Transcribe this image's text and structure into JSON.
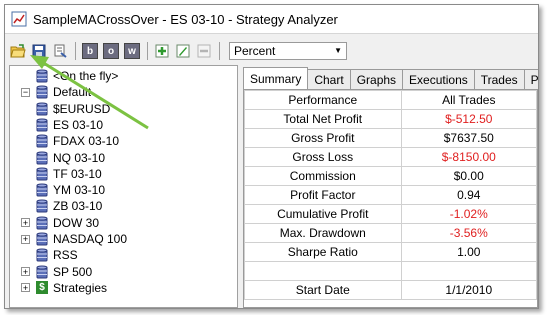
{
  "window": {
    "title": "SampleMACrossOver - ES 03-10 - Strategy Analyzer"
  },
  "toolbar": {
    "letter_buttons": [
      "b",
      "o",
      "w"
    ],
    "display_combo": "Percent"
  },
  "tree": {
    "items": [
      {
        "label": "<On the fly>",
        "level": 1,
        "expander": "",
        "icon": "database-icon"
      },
      {
        "label": "Default",
        "level": 0,
        "expander": "−",
        "icon": "database-icon"
      },
      {
        "label": "$EURUSD",
        "level": 1,
        "expander": "",
        "icon": "database-icon"
      },
      {
        "label": "ES 03-10",
        "level": 1,
        "expander": "",
        "icon": "database-icon"
      },
      {
        "label": "FDAX 03-10",
        "level": 1,
        "expander": "",
        "icon": "database-icon"
      },
      {
        "label": "NQ 03-10",
        "level": 1,
        "expander": "",
        "icon": "database-icon"
      },
      {
        "label": "TF 03-10",
        "level": 1,
        "expander": "",
        "icon": "database-icon"
      },
      {
        "label": "YM 03-10",
        "level": 1,
        "expander": "",
        "icon": "database-icon"
      },
      {
        "label": "ZB 03-10",
        "level": 1,
        "expander": "",
        "icon": "database-icon"
      },
      {
        "label": "DOW 30",
        "level": 0,
        "expander": "+",
        "icon": "database-icon"
      },
      {
        "label": "NASDAQ 100",
        "level": 0,
        "expander": "+",
        "icon": "database-icon"
      },
      {
        "label": "RSS",
        "level": 0,
        "expander": "",
        "icon": "database-icon"
      },
      {
        "label": "SP 500",
        "level": 0,
        "expander": "+",
        "icon": "database-icon"
      },
      {
        "label": "Strategies",
        "level": 0,
        "expander": "+",
        "icon": "strategy-icon"
      }
    ]
  },
  "tabs": [
    "Summary",
    "Chart",
    "Graphs",
    "Executions",
    "Trades",
    "Periods"
  ],
  "summary": {
    "headers": [
      "Performance",
      "All Trades"
    ],
    "rows": [
      {
        "label": "Total Net Profit",
        "value": "$-512.50",
        "negative": true
      },
      {
        "label": "Gross Profit",
        "value": "$7637.50",
        "negative": false
      },
      {
        "label": "Gross Loss",
        "value": "$-8150.00",
        "negative": true
      },
      {
        "label": "Commission",
        "value": "$0.00",
        "negative": false
      },
      {
        "label": "Profit Factor",
        "value": "0.94",
        "negative": false
      },
      {
        "label": "Cumulative Profit",
        "value": "-1.02%",
        "negative": true
      },
      {
        "label": "Max. Drawdown",
        "value": "-3.56%",
        "negative": true
      },
      {
        "label": "Sharpe Ratio",
        "value": "1.00",
        "negative": false
      },
      {
        "label": "",
        "value": "",
        "negative": false
      },
      {
        "label": "Start Date",
        "value": "1/1/2010",
        "negative": false
      }
    ]
  },
  "colors": {
    "negative_value": "#e02020",
    "annotation_arrow": "#7cc242"
  }
}
